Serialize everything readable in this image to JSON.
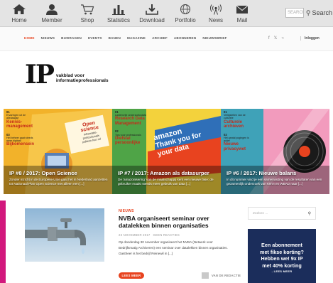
{
  "toolbar": {
    "items": [
      {
        "label": "Home",
        "icon": "house-icon"
      },
      {
        "label": "Member",
        "icon": "person-icon"
      },
      {
        "label": "Shop",
        "icon": "cart-icon"
      },
      {
        "label": "Statistics",
        "icon": "bar-chart-icon"
      },
      {
        "label": "Download",
        "icon": "download-icon"
      },
      {
        "label": "Portfolio",
        "icon": "globe-icon"
      },
      {
        "label": "News",
        "icon": "broadcast-icon"
      },
      {
        "label": "Mail",
        "icon": "envelope-icon"
      }
    ],
    "search_placeholder": "SEARCH",
    "search_label": "Search"
  },
  "nav": {
    "items": [
      "HOME",
      "NIEUWS",
      "BIJDRAGEN",
      "EVENTS",
      "BANEN",
      "MAGAZINE",
      "ARCHIEF",
      "ABONNEREN",
      "NIEUWSBRIEF"
    ],
    "active": "HOME",
    "social": {
      "facebook": "f",
      "twitter": "𝕏",
      "rss": "⌁"
    },
    "login": "Inloggen"
  },
  "logo": {
    "mark": "IP",
    "tagline": "vakblad voor informatieprofessionals"
  },
  "features": [
    {
      "title": "IP #8 / 2017: Open Science",
      "desc": "Zonder inzicht in de Europese Unie gaat het in Nederland aanzetten tot Nationaal Plan Open Science met alleen een [...]",
      "toc": {
        "num1": "01",
        "head1": "Ervaringen uit de alledaagse",
        "red1": "Kennis-management",
        "num2": "03",
        "head2": "Het beheer gaat steeds meer digitaal",
        "red2": "Bijkomensein"
      },
      "cover": {
        "lines": [
          "Open",
          "science",
          "Informatie-",
          "professionals",
          "pakken hun rol"
        ]
      }
    },
    {
      "title": "IP #7 / 2017: Amazon als datasurper",
      "desc": "De 'amazonisering' van de maatschappij kent een nieuwe fase: de gebruiker maakt steeds meer gebruik van data [...]",
      "toc": {
        "num1": "01",
        "head1": "Lastenvrije onderzoeksdata",
        "red1": "Research Data Management",
        "num2": "02",
        "head2": "Tips voor professionals",
        "red2": "Diefstal persoonlijke"
      },
      "cover": {
        "lines": [
          "amazon",
          "Thank you for",
          "your data"
        ]
      }
    },
    {
      "title": "IP #6 / 2017: Nieuwe balans",
      "desc": "In dit nummer vind je een samenvatting van de resultaten van een gezamenlijk onderzoek van KNVI en WBAD naar [...]",
      "toc": {
        "num1": "01",
        "head1": "Veiligstellen van de culturele",
        "red1": "Culturele archieven",
        "num2": "02",
        "head2": "Het aantal pogingen is actief",
        "red2": "Nieuwe privacywet"
      },
      "cover": {
        "lines": []
      }
    }
  ],
  "article": {
    "category": "NIEUWS",
    "title": "NVBA organiseert seminar over datalekken binnen organisaties",
    "date": "23 NOVEMBER 2017",
    "comments": "GEEN REACTIES",
    "body": "Op donderdag 30 november organiseert het NVBA (Netwerk voor Bedrijfsmatig Archiveren) een seminar over datalekken binnen organisaties. Gastheer is het bedrijf Reinewil in [...]",
    "read_more": "LEES MEER",
    "author": "VAN DE REDACTIE"
  },
  "sidebar": {
    "search_placeholder": "Zoeken ...",
    "promo_lines": [
      "Een abonnement",
      "met fikse korting?",
      "Hebben we! 9x IP",
      "met 40% korting"
    ],
    "promo_cta": "- LEES MEER"
  },
  "colors": {
    "accent": "#e8431f",
    "promo_bg": "#1b2d5b",
    "feature_yellow": "#f2b22a",
    "feature_green": "#4fa447",
    "feature_teal": "#3fa2b8",
    "edge_magenta": "#d2187d"
  }
}
